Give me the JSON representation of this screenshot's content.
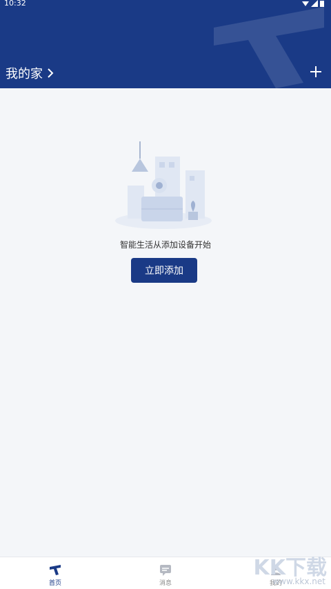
{
  "status": {
    "time": "10:32"
  },
  "header": {
    "title": "我的家"
  },
  "empty": {
    "message": "智能生活从添加设备开始",
    "button_label": "立即添加"
  },
  "nav": {
    "items": [
      {
        "label": "首页",
        "active": true,
        "icon": "home-logo-icon"
      },
      {
        "label": "消息",
        "active": false,
        "icon": "message-icon"
      },
      {
        "label": "我的",
        "active": false,
        "icon": "profile-icon"
      }
    ]
  },
  "watermark": {
    "brand": "KK下载",
    "url": "www.kkx.net"
  },
  "colors": {
    "primary": "#1a3a86",
    "background": "#f4f6f9"
  }
}
